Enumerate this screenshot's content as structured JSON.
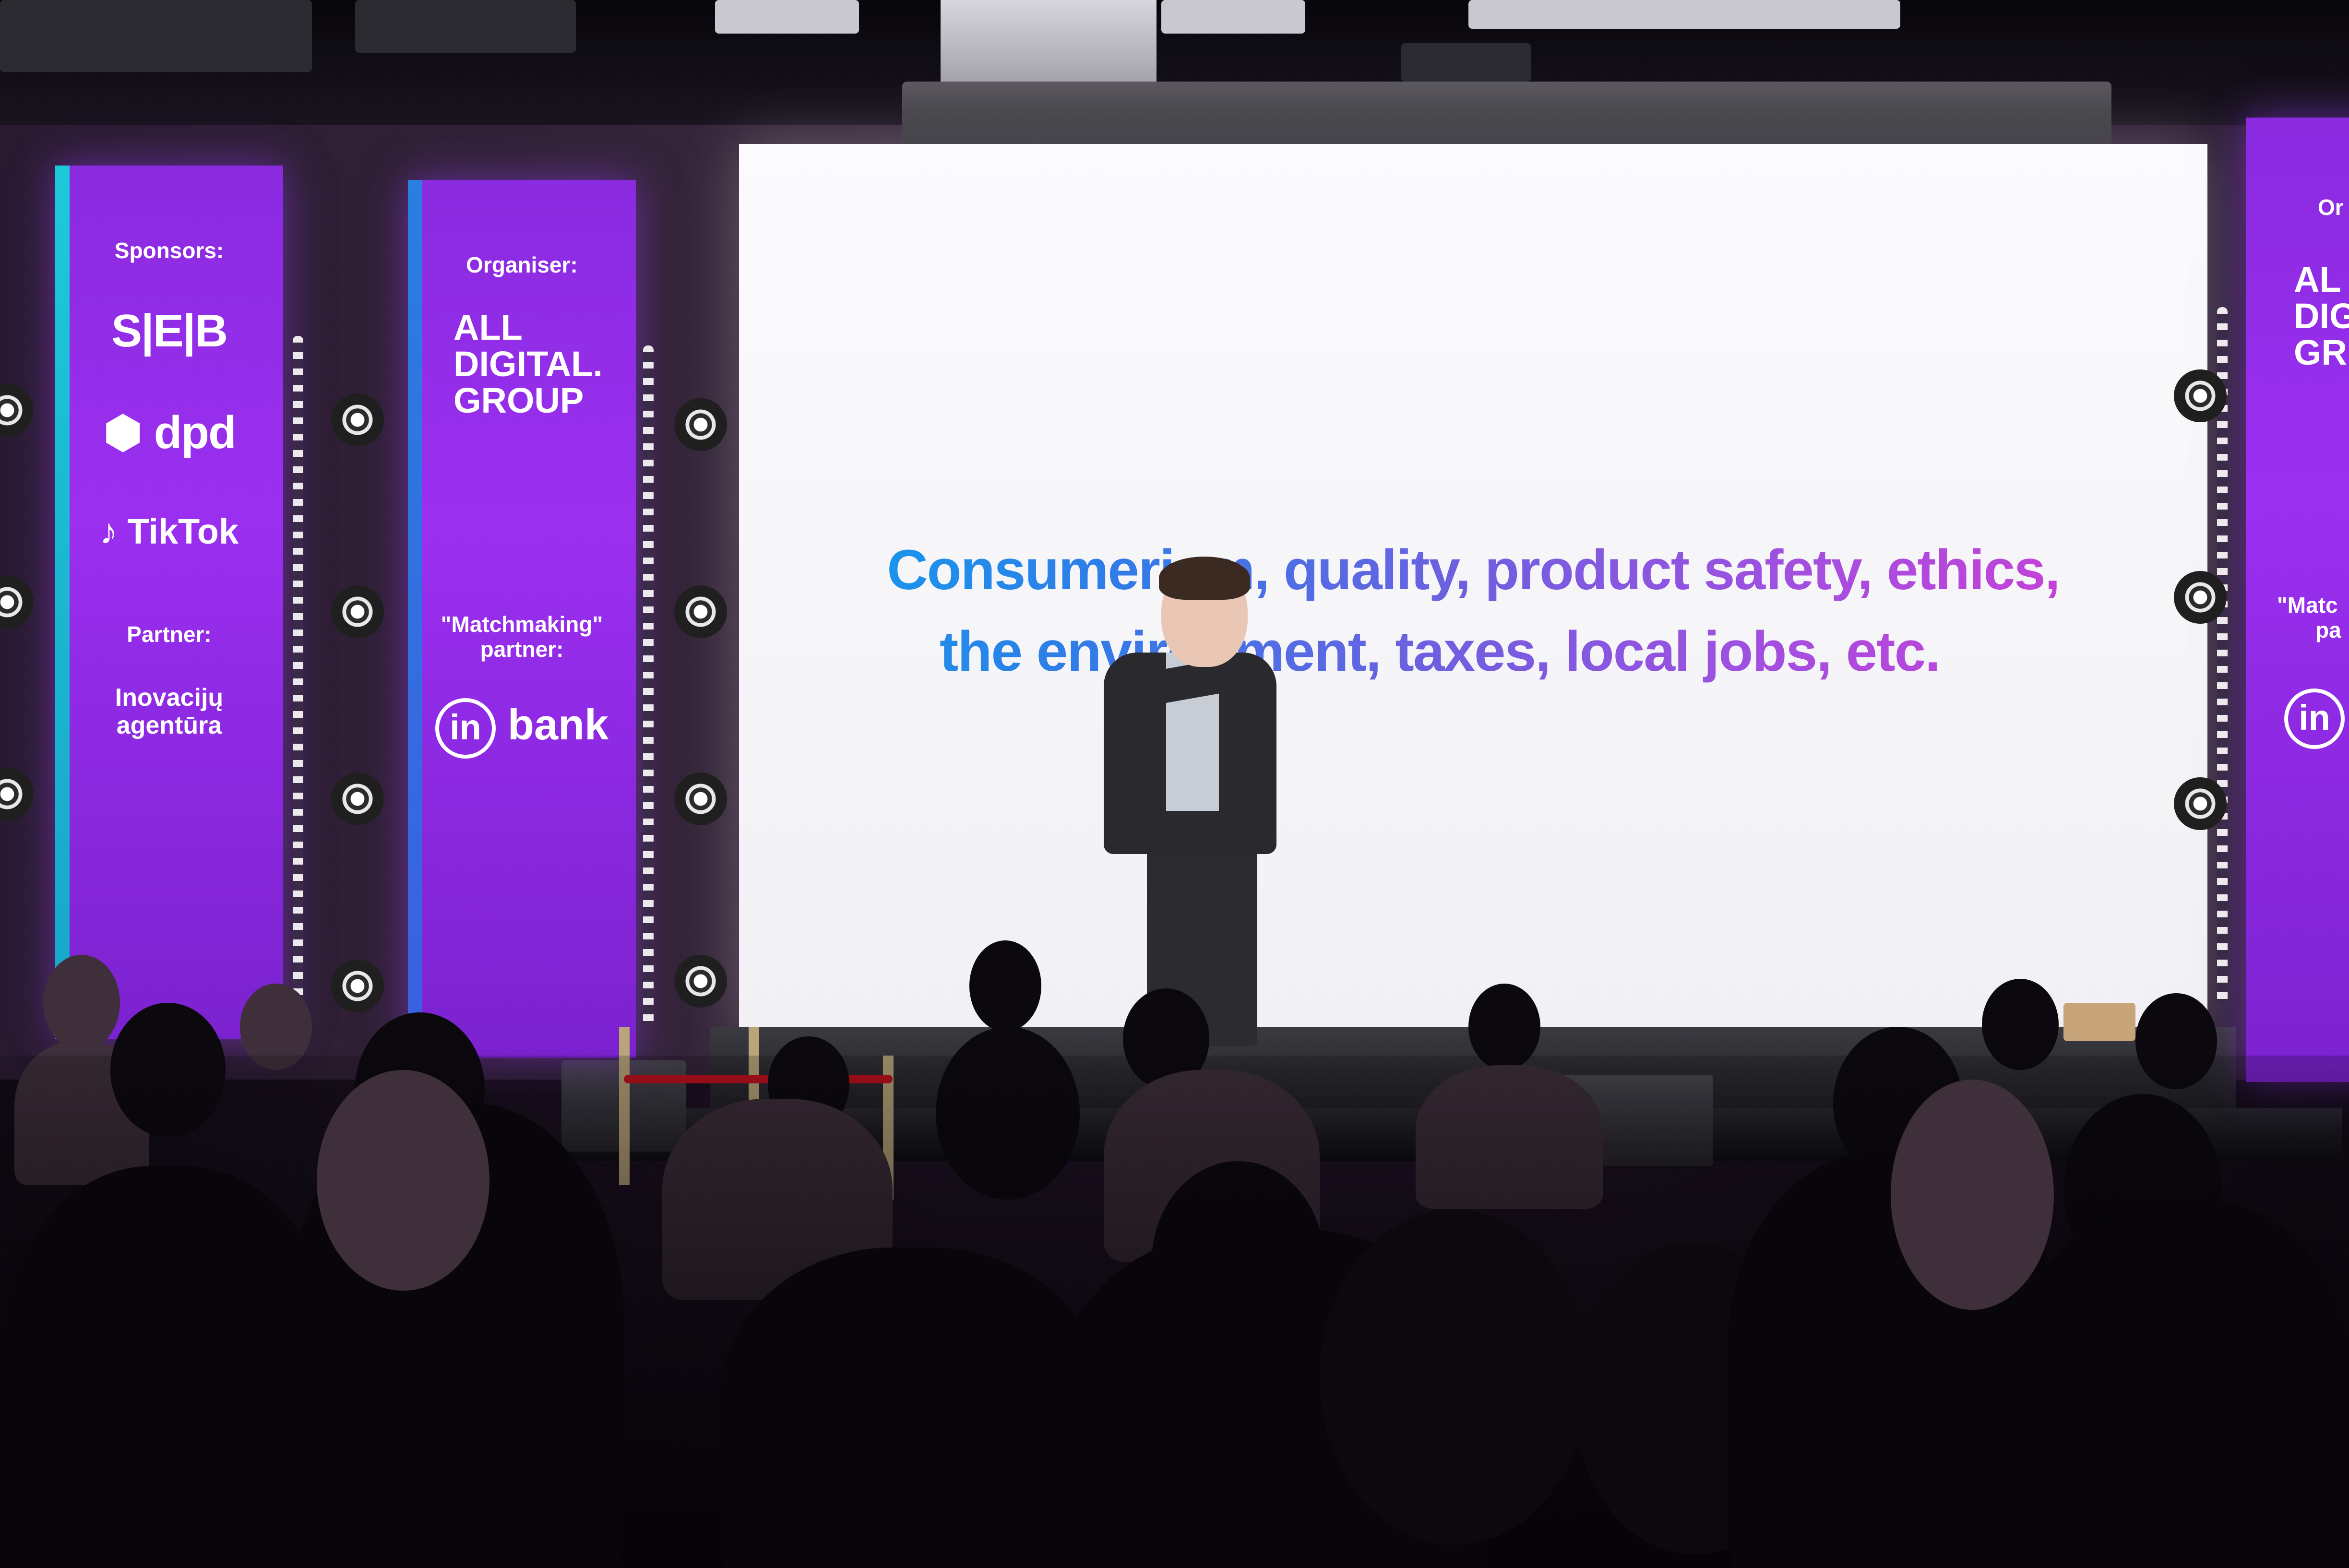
{
  "slide": {
    "line1": "Consumerism, quality, product safety, ethics,",
    "line2": "the environment, taxes, local jobs, etc."
  },
  "banner_left": {
    "sponsors_label": "Sponsors:",
    "logo_seb": "S|E|B",
    "logo_dpd": "dpd",
    "logo_tiktok": "TikTok",
    "partner_label": "Partner:",
    "logo_inovaciju_1": "Inovacijų",
    "logo_inovaciju_2": "agentūra"
  },
  "banner_middle": {
    "organiser_label": "Organiser:",
    "logo_adg_1": "ALL",
    "logo_adg_2": "DIGITAL.",
    "logo_adg_3": "GROUP",
    "matchmaking_label_1": "\"Matchmaking\"",
    "matchmaking_label_2": "partner:",
    "logo_inbank_in": "in",
    "logo_inbank_bank": "bank"
  },
  "banner_right": {
    "organiser_label": "Or",
    "logo_adg_1": "AL",
    "logo_adg_2": "DIG",
    "logo_adg_3": "GR",
    "matchmaking_label_1": "\"Matc",
    "matchmaking_label_2": "pa",
    "logo_inbank_in": "in"
  },
  "colors": {
    "banner_purple": "#9b2ff0",
    "banner_edge_cyan": "#1cc9d9",
    "slide_gradient_start": "#0ea3ee",
    "slide_gradient_end": "#d63bd3"
  }
}
